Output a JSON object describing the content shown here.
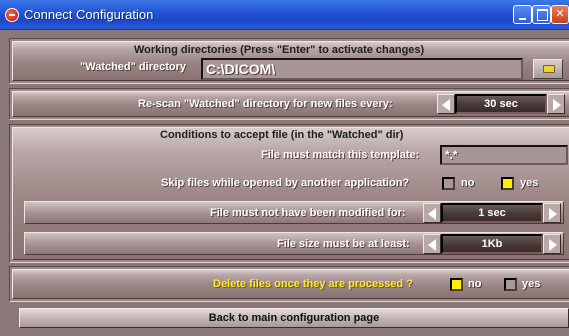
{
  "window": {
    "title": "Connect Configuration"
  },
  "working_dirs": {
    "heading": "Working directories (Press \"Enter\" to activate changes)",
    "watched_label": "\"Watched\" directory",
    "watched_value": "C:\\DICOM\\"
  },
  "rescan": {
    "label": "Re-scan \"Watched\" directory for new files every:",
    "value": "30 sec"
  },
  "conditions": {
    "heading": "Conditions to accept file (in the \"Watched\" dir)",
    "template_label": "File must match this template:",
    "template_value": "*.*",
    "skip_label": "Skip files while opened by another application?",
    "skip_no": "no",
    "skip_yes": "yes",
    "skip_selected": "yes",
    "modified_label": "File must not have been modified for:",
    "modified_value": "1 sec",
    "size_label": "File size must be at least:",
    "size_value": "1Kb"
  },
  "delete": {
    "label": "Delete files once they are processed ?",
    "no": "no",
    "yes": "yes",
    "selected": "no"
  },
  "back_button": "Back to main configuration page",
  "colors": {
    "titlebar": "#2456d6",
    "panel": "#9a8484",
    "checked": "#ffee00",
    "highlight_text": "#ffee20"
  }
}
